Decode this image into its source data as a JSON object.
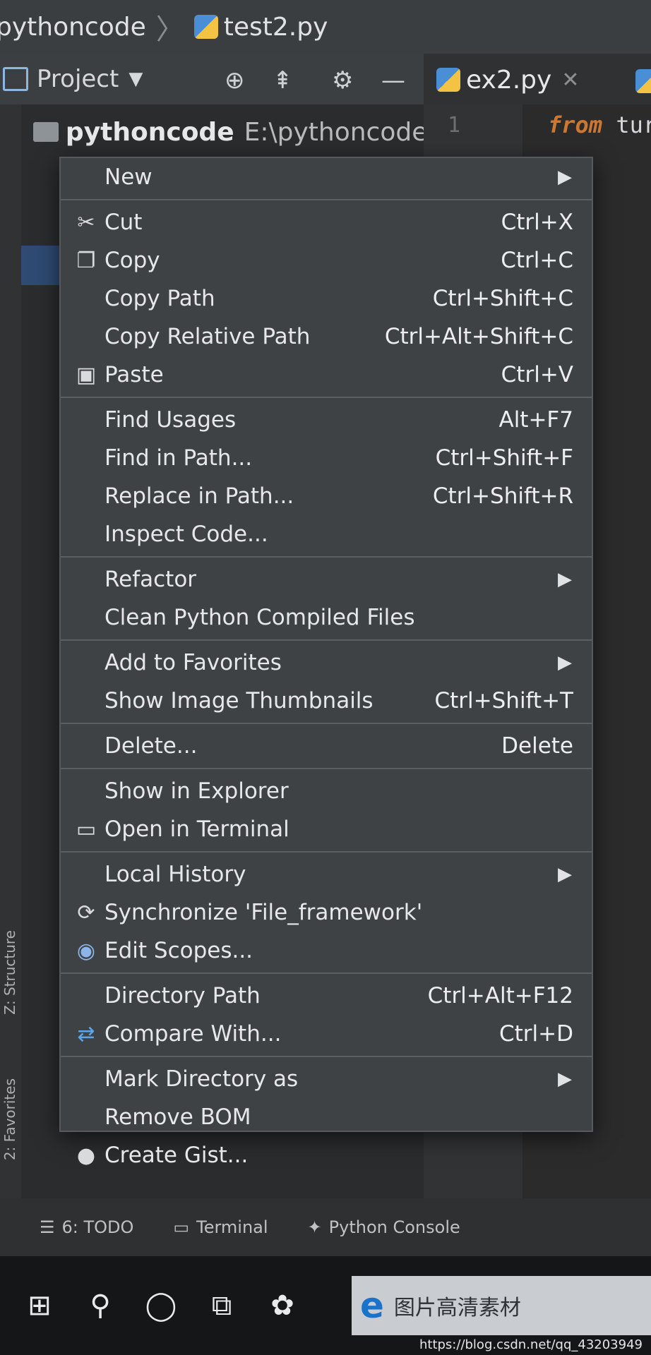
{
  "breadcrumb": {
    "project": "pythoncode",
    "file": "test2.py"
  },
  "project_panel": {
    "title": "Project"
  },
  "tree": {
    "root_name": "pythoncode",
    "root_path": "E:\\pythoncode"
  },
  "editor": {
    "tab": {
      "label": "ex2.py"
    },
    "line_number": "1",
    "code_line": {
      "keyword": "from",
      "rest": " tur"
    }
  },
  "context_menu": {
    "items": [
      {
        "label": "New",
        "submenu": true
      },
      {
        "label": "Cut",
        "shortcut": "Ctrl+X",
        "icon": "scissors-icon"
      },
      {
        "label": "Copy",
        "shortcut": "Ctrl+C",
        "icon": "copy-icon"
      },
      {
        "label": "Copy Path",
        "shortcut": "Ctrl+Shift+C"
      },
      {
        "label": "Copy Relative Path",
        "shortcut": "Ctrl+Alt+Shift+C"
      },
      {
        "label": "Paste",
        "shortcut": "Ctrl+V",
        "icon": "clipboard-icon"
      },
      {
        "label": "Find Usages",
        "shortcut": "Alt+F7"
      },
      {
        "label": "Find in Path...",
        "shortcut": "Ctrl+Shift+F"
      },
      {
        "label": "Replace in Path...",
        "shortcut": "Ctrl+Shift+R"
      },
      {
        "label": "Inspect Code..."
      },
      {
        "label": "Refactor",
        "submenu": true
      },
      {
        "label": "Clean Python Compiled Files"
      },
      {
        "label": "Add to Favorites",
        "submenu": true
      },
      {
        "label": "Show Image Thumbnails",
        "shortcut": "Ctrl+Shift+T"
      },
      {
        "label": "Delete...",
        "shortcut": "Delete"
      },
      {
        "label": "Show in Explorer"
      },
      {
        "label": "Open in Terminal",
        "icon": "terminal-icon"
      },
      {
        "label": "Local History",
        "submenu": true
      },
      {
        "label": "Synchronize 'File_framework'",
        "icon": "sync-icon"
      },
      {
        "label": "Edit Scopes...",
        "icon": "scope-icon"
      },
      {
        "label": "Directory Path",
        "shortcut": "Ctrl+Alt+F12"
      },
      {
        "label": "Compare With...",
        "shortcut": "Ctrl+D",
        "icon": "compare-icon"
      },
      {
        "label": "Mark Directory as",
        "submenu": true
      },
      {
        "label": "Remove BOM"
      },
      {
        "label": "Create Gist...",
        "icon": "github-icon"
      }
    ]
  },
  "bottom_tools": {
    "todo": "6: TODO",
    "terminal": "Terminal",
    "python_console": "Python Console"
  },
  "side_tabs": {
    "structure": "Z: Structure",
    "favorites": "2: Favorites"
  },
  "taskbar": {
    "ie_title": "图片高清素材"
  },
  "watermark": "https://blog.csdn.net/qq_43203949"
}
